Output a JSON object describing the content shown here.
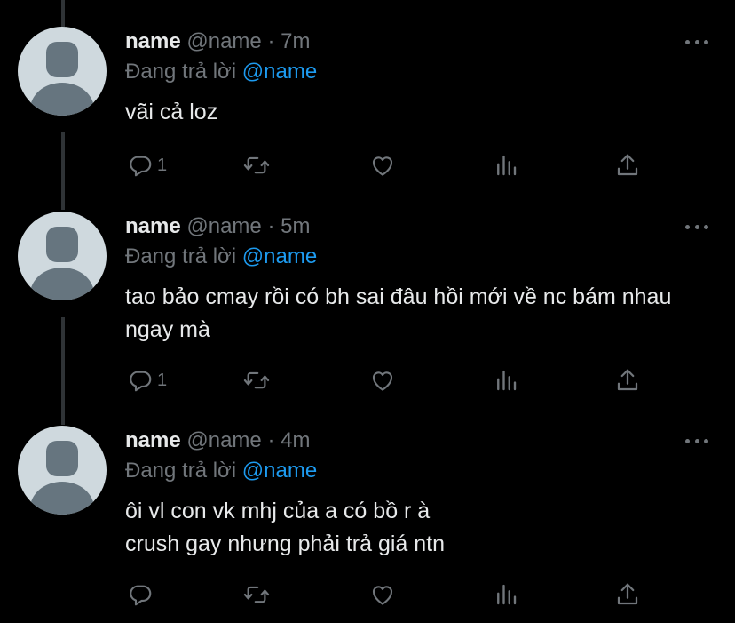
{
  "theme": {
    "background": "#000000",
    "text": "#e7e9ea",
    "muted": "#71767b",
    "accent": "#1d9bf0"
  },
  "tweets": [
    {
      "name": "name",
      "handle": "@name",
      "dot": "·",
      "time": "7m",
      "reply_label": "Đang trả lời",
      "reply_to": "@name",
      "text": "vãi cả loz",
      "reply_count": "1",
      "icons": [
        "reply-icon",
        "retweet-icon",
        "like-icon",
        "analytics-icon",
        "share-icon",
        "more-icon"
      ]
    },
    {
      "name": "name",
      "handle": "@name",
      "dot": "·",
      "time": "5m",
      "reply_label": "Đang trả lời",
      "reply_to": "@name",
      "text": "tao bảo cmay rồi có bh sai đâu hồi mới về nc bám nhau ngay mà",
      "reply_count": "1",
      "icons": [
        "reply-icon",
        "retweet-icon",
        "like-icon",
        "analytics-icon",
        "share-icon",
        "more-icon"
      ]
    },
    {
      "name": "name",
      "handle": "@name",
      "dot": "·",
      "time": "4m",
      "reply_label": "Đang trả lời",
      "reply_to": "@name",
      "text_lines": [
        "ôi vl con vk mhj của a có bồ r à",
        "crush gay nhưng phải trả giá ntn"
      ],
      "reply_count": "",
      "icons": [
        "reply-icon",
        "retweet-icon",
        "like-icon",
        "analytics-icon",
        "share-icon",
        "more-icon"
      ]
    }
  ]
}
